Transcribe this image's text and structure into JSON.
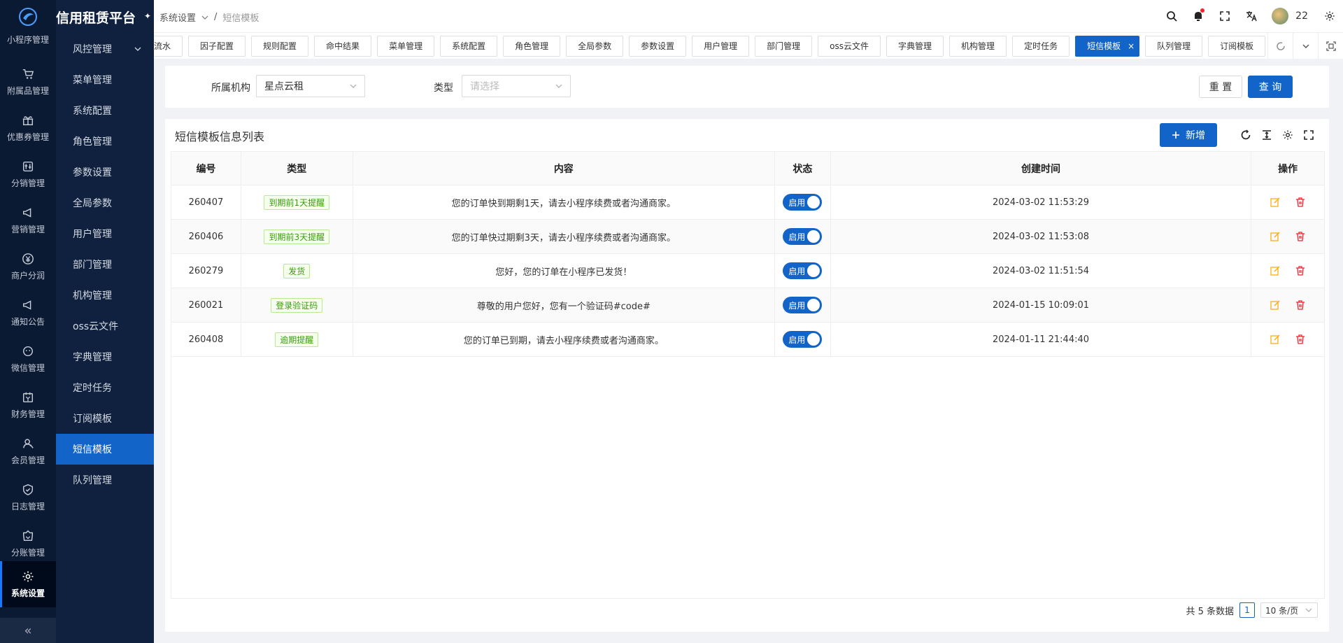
{
  "brand": {
    "title": "信用租赁平台"
  },
  "rail": {
    "partial_label": "小程序管理",
    "items": [
      {
        "label": "附属品管理",
        "icon": "cart-icon"
      },
      {
        "label": "优惠券管理",
        "icon": "gift-icon"
      },
      {
        "label": "分销管理",
        "icon": "distribution-icon"
      },
      {
        "label": "营销管理",
        "icon": "megaphone-icon"
      },
      {
        "label": "商户分润",
        "icon": "yen-icon"
      },
      {
        "label": "通知公告",
        "icon": "megaphone-icon"
      },
      {
        "label": "微信管理",
        "icon": "wechat-icon"
      },
      {
        "label": "财务管理",
        "icon": "finance-icon"
      },
      {
        "label": "会员管理",
        "icon": "member-icon"
      },
      {
        "label": "日志管理",
        "icon": "shield-check-icon"
      },
      {
        "label": "分账管理",
        "icon": "split-icon"
      }
    ],
    "active": {
      "label": "系统设置",
      "icon": "gear-icon"
    },
    "collapse": "«"
  },
  "submenu": {
    "items": [
      {
        "label": "风控管理",
        "has_caret": true
      },
      {
        "label": "菜单管理"
      },
      {
        "label": "系统配置"
      },
      {
        "label": "角色管理"
      },
      {
        "label": "参数设置"
      },
      {
        "label": "全局参数"
      },
      {
        "label": "用户管理"
      },
      {
        "label": "部门管理"
      },
      {
        "label": "机构管理"
      },
      {
        "label": "oss云文件"
      },
      {
        "label": "字典管理"
      },
      {
        "label": "定时任务"
      },
      {
        "label": "订阅模板"
      },
      {
        "label": "短信模板",
        "active": true
      },
      {
        "label": "队列管理"
      }
    ]
  },
  "breadcrumb": {
    "parent": "系统设置",
    "separator": "/",
    "current": "短信模板"
  },
  "user": {
    "name": "22"
  },
  "tabs": [
    {
      "label": "流水"
    },
    {
      "label": "因子配置"
    },
    {
      "label": "规则配置"
    },
    {
      "label": "命中结果"
    },
    {
      "label": "菜单管理"
    },
    {
      "label": "系统配置"
    },
    {
      "label": "角色管理"
    },
    {
      "label": "全局参数"
    },
    {
      "label": "参数设置"
    },
    {
      "label": "用户管理"
    },
    {
      "label": "部门管理"
    },
    {
      "label": "oss云文件"
    },
    {
      "label": "字典管理"
    },
    {
      "label": "机构管理"
    },
    {
      "label": "定时任务"
    },
    {
      "label": "短信模板",
      "active": true
    },
    {
      "label": "队列管理"
    },
    {
      "label": "订阅模板"
    },
    {
      "label": "..."
    }
  ],
  "filter": {
    "org_label": "所属机构",
    "org_value": "星点云租",
    "type_label": "类型",
    "type_placeholder": "请选择",
    "reset": "重 置",
    "query": "查 询"
  },
  "list": {
    "title": "短信模板信息列表",
    "add": "新增",
    "columns": [
      "编号",
      "类型",
      "内容",
      "状态",
      "创建时间",
      "操作"
    ],
    "rows": [
      {
        "id": "260407",
        "type": "到期前1天提醒",
        "content": "您的订单快到期剩1天，请去小程序续费或者沟通商家。",
        "status": "启用",
        "created": "2024-03-02 11:53:29"
      },
      {
        "id": "260406",
        "type": "到期前3天提醒",
        "content": "您的订单快过期剩3天，请去小程序续费或者沟通商家。",
        "status": "启用",
        "created": "2024-03-02 11:53:08"
      },
      {
        "id": "260279",
        "type": "发货",
        "content": "您好，您的订单在小程序已发货！",
        "status": "启用",
        "created": "2024-03-02 11:51:54"
      },
      {
        "id": "260021",
        "type": "登录验证码",
        "content": "尊敬的用户您好，您有一个验证码#code#",
        "status": "启用",
        "created": "2024-01-15 10:09:01"
      },
      {
        "id": "260408",
        "type": "逾期提醒",
        "content": "您的订单已到期，请去小程序续费或者沟通商家。",
        "status": "启用",
        "created": "2024-01-11 21:44:40"
      }
    ]
  },
  "pagination": {
    "total": "共 5 条数据",
    "page": "1",
    "page_size": "10 条/页"
  },
  "colors": {
    "primary": "#1264c8",
    "sidebar": "#0f213f",
    "rail": "#0b1a33",
    "tag_green": "#389e0d",
    "edit": "#faad14",
    "delete": "#f5222d"
  }
}
